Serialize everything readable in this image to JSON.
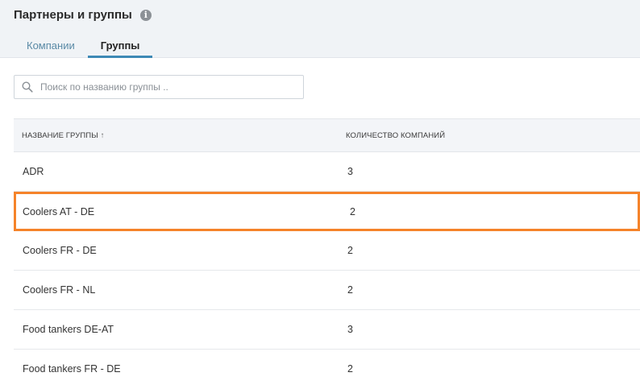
{
  "header": {
    "title": "Партнеры и группы",
    "info_icon": "info-icon"
  },
  "tabs": [
    {
      "label": "Компании",
      "active": false
    },
    {
      "label": "Группы",
      "active": true
    }
  ],
  "search": {
    "placeholder": "Поиск по названию группы ..",
    "value": "",
    "icon": "search-icon"
  },
  "table": {
    "columns": {
      "name": "НАЗВАНИЕ ГРУППЫ",
      "name_sort": "↑",
      "count": "КОЛИЧЕСТВО КОМПАНИЙ"
    },
    "rows": [
      {
        "name": "ADR",
        "count": "3"
      },
      {
        "name": "Coolers AT - DE",
        "count": "2",
        "highlighted": true
      },
      {
        "name": "Coolers FR - DE",
        "count": "2"
      },
      {
        "name": "Coolers FR - NL",
        "count": "2"
      },
      {
        "name": "Food tankers DE-AT",
        "count": "3"
      },
      {
        "name": "Food tankers FR - DE",
        "count": "2"
      }
    ]
  },
  "colors": {
    "accent": "#3d89b5",
    "highlight": "#f5832a",
    "header_bg": "#f0f3f6"
  }
}
